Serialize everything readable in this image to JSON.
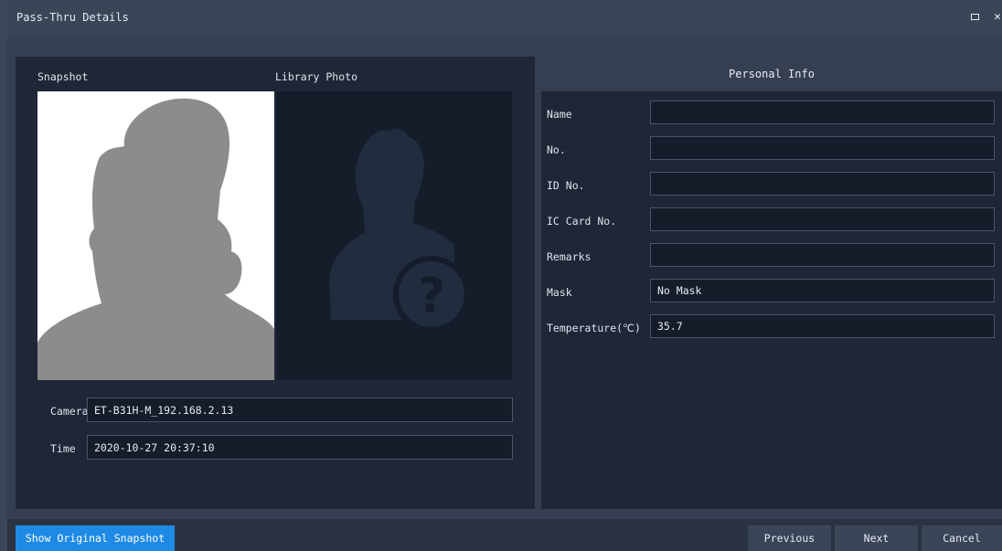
{
  "window": {
    "title": "Pass-Thru Details",
    "maximize_icon": "maximize-icon",
    "close_icon": "close-icon",
    "close_glyph": "✕"
  },
  "left": {
    "snapshot_label": "Snapshot",
    "library_label": "Library Photo",
    "camera_label": "Camera",
    "camera_value": "ET-B31H-M_192.168.2.13",
    "time_label": "Time",
    "time_value": "2020-10-27 20:37:10"
  },
  "personal_info": {
    "header": "Personal Info",
    "fields": [
      {
        "label": "Name",
        "value": ""
      },
      {
        "label": "No.",
        "value": ""
      },
      {
        "label": "ID No.",
        "value": ""
      },
      {
        "label": "IC Card No.",
        "value": ""
      },
      {
        "label": "Remarks",
        "value": ""
      },
      {
        "label": "Mask",
        "value": "No Mask"
      },
      {
        "label": "Temperature(℃)",
        "value": "35.7"
      }
    ]
  },
  "footer": {
    "show_original": "Show Original Snapshot",
    "previous": "Previous",
    "next": "Next",
    "cancel": "Cancel"
  },
  "colors": {
    "primary": "#1e8ae6",
    "panel": "#1f2737",
    "background": "#2b3343"
  }
}
